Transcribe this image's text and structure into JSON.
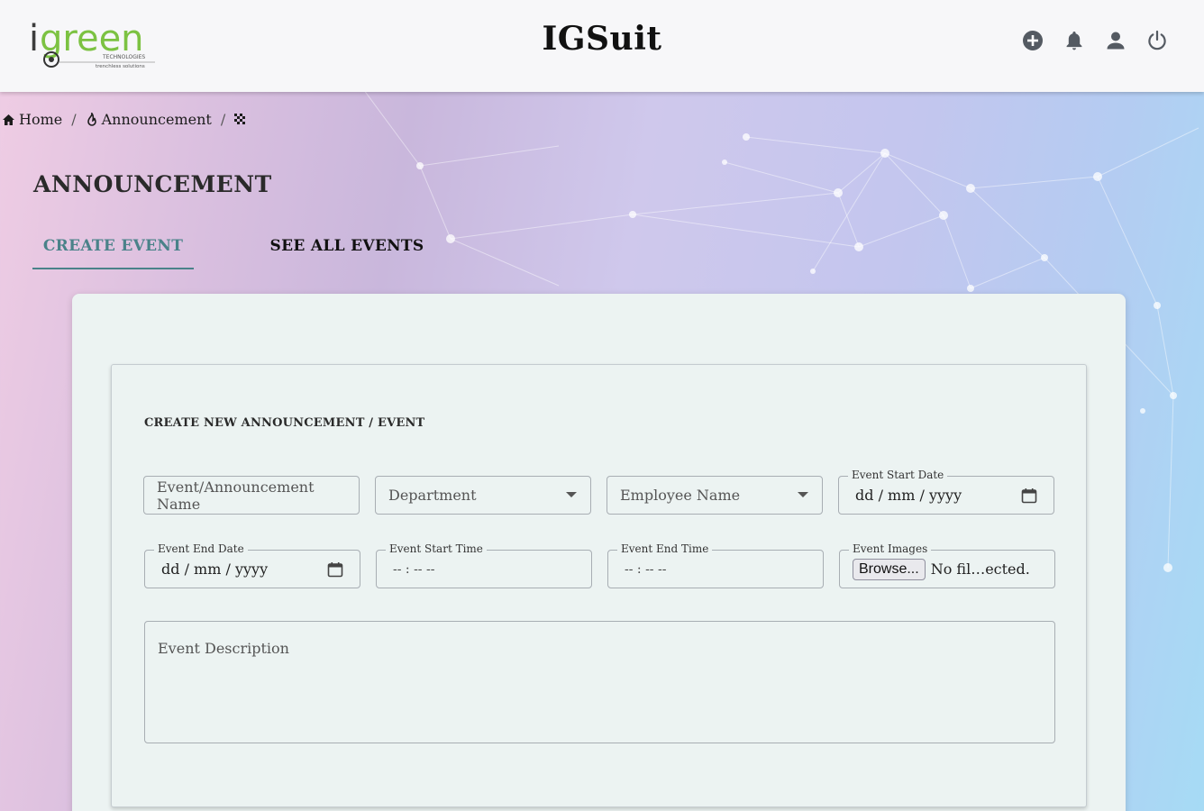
{
  "header": {
    "logo_text": "green",
    "logo_sub1": "TECHNOLOGIES",
    "logo_sub2": "trenchless solutions",
    "app_title": "IGSuit",
    "icons": [
      "add-circle-icon",
      "bell-icon",
      "user-icon",
      "power-icon"
    ]
  },
  "breadcrumb": {
    "items": [
      {
        "label": "Home",
        "icon": "home-icon"
      },
      {
        "label": "Announcement",
        "icon": "fire-icon"
      },
      {
        "label": "",
        "icon": "checker-icon"
      }
    ],
    "separator": "/"
  },
  "page_title": "ANNOUNCEMENT",
  "tabs": [
    {
      "label": "CREATE EVENT",
      "active": true
    },
    {
      "label": "SEE ALL EVENTS",
      "active": false
    }
  ],
  "form": {
    "heading": "CREATE NEW ANNOUNCEMENT / EVENT",
    "event_name_placeholder": "Event/Announcement Name",
    "department_placeholder": "Department",
    "employee_placeholder": "Employee Name",
    "start_date_label": "Event Start Date",
    "start_date_value": "dd / mm / yyyy",
    "end_date_label": "Event End Date",
    "end_date_value": "dd / mm / yyyy",
    "start_time_label": "Event Start Time",
    "start_time_value": "-- : --  --",
    "end_time_label": "Event End Time",
    "end_time_value": "-- : --  --",
    "images_label": "Event Images",
    "browse_label": "Browse...",
    "file_status": "No fil…ected.",
    "description_placeholder": "Event Description"
  },
  "colors": {
    "accent": "#4a8289",
    "logo_green": "#7cc242",
    "header_bg": "#f7f7f9",
    "card_bg": "#ecf3f2"
  }
}
